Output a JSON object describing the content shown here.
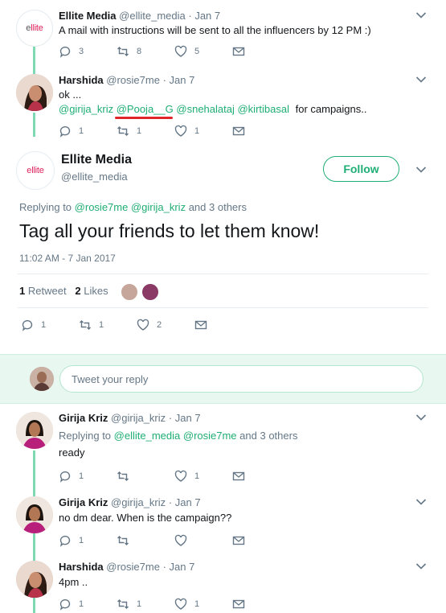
{
  "tweets": [
    {
      "name": "Ellite Media",
      "handle": "@ellite_media",
      "sep": "·",
      "time": "Jan 7",
      "text": "A mail with instructions will be sent to all the influencers by 12 PM :)",
      "reply_count": "3",
      "retweet_count": "8",
      "like_count": "5"
    },
    {
      "name": "Harshida",
      "handle": "@rosie7me",
      "sep": "·",
      "time": "Jan 7",
      "text_line1": "ok ...",
      "mentions": [
        "@girija_kriz",
        "@Pooja__G",
        "@snehalataj",
        "@kirtibasal"
      ],
      "text_suffix": "for campaigns..",
      "reply_count": "1",
      "retweet_count": "1",
      "like_count": "1"
    }
  ],
  "focused": {
    "brand_logo": "ellite",
    "name": "Ellite Media",
    "handle": "@ellite_media",
    "follow_label": "Follow",
    "replying_prefix": "Replying to",
    "replying_mention1": "@rosie7me",
    "replying_mention2": "@girija_kriz",
    "replying_suffix": "and 3 others",
    "text": "Tag all your friends to let them know!",
    "timestamp": "11:02 AM - 7 Jan 2017",
    "retweets_num": "1",
    "retweets_label": "Retweet",
    "likes_num": "2",
    "likes_label": "Likes",
    "reply_count": "1",
    "retweet_count": "1",
    "like_count": "2"
  },
  "reply_box": {
    "placeholder": "Tweet your reply"
  },
  "replies": [
    {
      "name": "Girija Kriz",
      "handle": "@girija_kriz",
      "sep": "·",
      "time": "Jan 7",
      "replying_prefix": "Replying to",
      "replying_mention1": "@ellite_media",
      "replying_mention2": "@rosie7me",
      "replying_suffix": "and 3 others",
      "text": "ready",
      "reply_count": "1",
      "like_count": "1"
    },
    {
      "name": "Girija Kriz",
      "handle": "@girija_kriz",
      "sep": "·",
      "time": "Jan 7",
      "text": "no dm dear. When is the campaign??",
      "reply_count": "1",
      "like_count": ""
    },
    {
      "name": "Harshida",
      "handle": "@rosie7me",
      "sep": "·",
      "time": "Jan 7",
      "text": "4pm ..",
      "reply_count": "1",
      "retweet_count": "1",
      "like_count": "1"
    }
  ],
  "colors": {
    "accent": "#1fae74",
    "thread_line": "#7fd9b3",
    "highlight_underline": "#e0242a",
    "reply_band": "#e8f7f0"
  }
}
